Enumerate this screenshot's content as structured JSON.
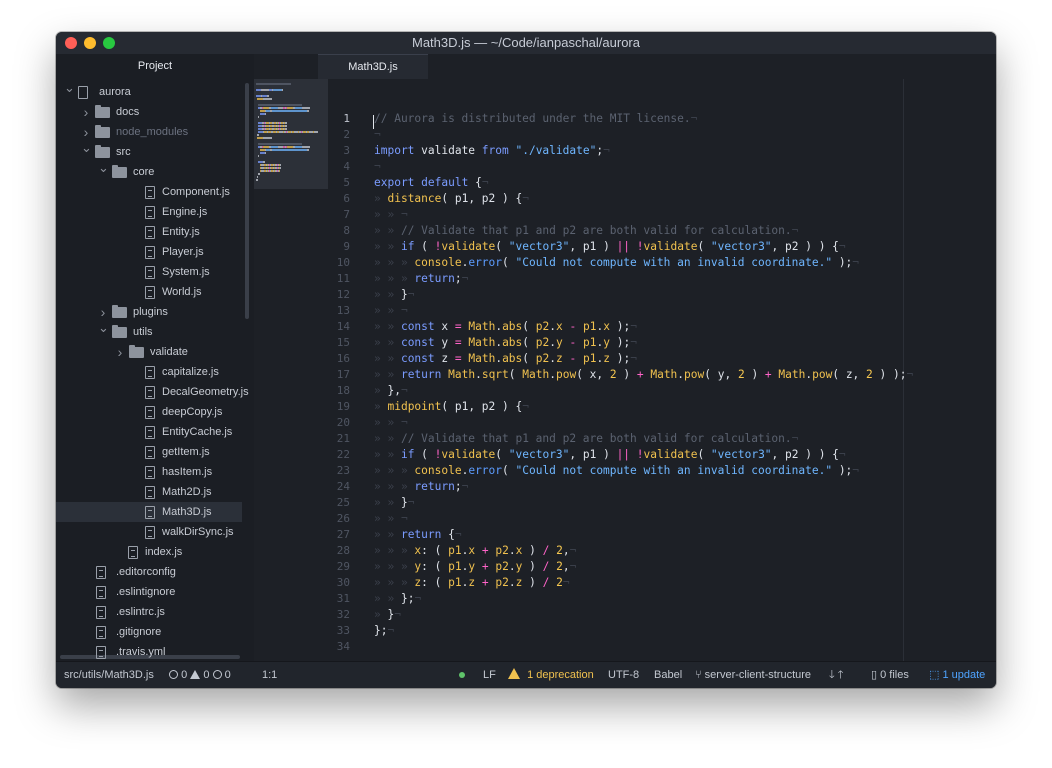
{
  "window": {
    "title": "Math3D.js — ~/Code/ianpaschal/aurora"
  },
  "tabs": {
    "project": "Project",
    "file": "Math3D.js"
  },
  "tree": [
    {
      "label": "aurora",
      "type": "repo",
      "chev": "down",
      "depth": 0
    },
    {
      "label": "docs",
      "type": "folder",
      "chev": "right",
      "depth": 1
    },
    {
      "label": "node_modules",
      "type": "folder",
      "chev": "right",
      "depth": 1,
      "dim": true
    },
    {
      "label": "src",
      "type": "folder",
      "chev": "down",
      "depth": 1
    },
    {
      "label": "core",
      "type": "folder",
      "chev": "down",
      "depth": 2
    },
    {
      "label": "Component.js",
      "type": "file",
      "depth": 3
    },
    {
      "label": "Engine.js",
      "type": "file",
      "depth": 3
    },
    {
      "label": "Entity.js",
      "type": "file",
      "depth": 3
    },
    {
      "label": "Player.js",
      "type": "file",
      "depth": 3
    },
    {
      "label": "System.js",
      "type": "file",
      "depth": 3
    },
    {
      "label": "World.js",
      "type": "file",
      "depth": 3
    },
    {
      "label": "plugins",
      "type": "folder",
      "chev": "right",
      "depth": 2
    },
    {
      "label": "utils",
      "type": "folder",
      "chev": "down",
      "depth": 2
    },
    {
      "label": "validate",
      "type": "folder",
      "chev": "right",
      "depth": 3
    },
    {
      "label": "capitalize.js",
      "type": "file",
      "depth": 3
    },
    {
      "label": "DecalGeometry.js",
      "type": "file",
      "depth": 3
    },
    {
      "label": "deepCopy.js",
      "type": "file",
      "depth": 3
    },
    {
      "label": "EntityCache.js",
      "type": "file",
      "depth": 3
    },
    {
      "label": "getItem.js",
      "type": "file",
      "depth": 3
    },
    {
      "label": "hasItem.js",
      "type": "file",
      "depth": 3
    },
    {
      "label": "Math2D.js",
      "type": "file",
      "depth": 3
    },
    {
      "label": "Math3D.js",
      "type": "file",
      "depth": 3,
      "selected": true
    },
    {
      "label": "walkDirSync.js",
      "type": "file",
      "depth": 3
    },
    {
      "label": "index.js",
      "type": "file",
      "depth": 2
    },
    {
      "label": ".editorconfig",
      "type": "file",
      "depth": 1
    },
    {
      "label": ".eslintignore",
      "type": "file",
      "depth": 1
    },
    {
      "label": ".eslintrc.js",
      "type": "file",
      "depth": 1
    },
    {
      "label": ".gitignore",
      "type": "file",
      "depth": 1
    },
    {
      "label": ".travis.yml",
      "type": "file",
      "depth": 1
    }
  ],
  "code": [
    [
      [
        "// Aurora is distributed under the MIT license.",
        "com"
      ],
      [
        "¬",
        "inv"
      ]
    ],
    [
      [
        "¬",
        "inv"
      ]
    ],
    [
      [
        "import",
        "kw"
      ],
      [
        " validate ",
        ""
      ],
      [
        "from",
        "kw"
      ],
      [
        " ",
        ""
      ],
      [
        "\"./validate\"",
        "str"
      ],
      [
        ";",
        ""
      ],
      [
        "¬",
        "inv"
      ]
    ],
    [
      [
        "¬",
        "inv"
      ]
    ],
    [
      [
        "export",
        "kw"
      ],
      [
        " ",
        ""
      ],
      [
        "default",
        "kw"
      ],
      [
        " {",
        ""
      ],
      [
        "¬",
        "inv"
      ]
    ],
    [
      [
        "» ",
        "inv"
      ],
      [
        "distance",
        "fn"
      ],
      [
        "( p1, p2 ) {",
        ""
      ],
      [
        "¬",
        "inv"
      ]
    ],
    [
      [
        "» » ",
        "inv"
      ],
      [
        "¬",
        "inv"
      ]
    ],
    [
      [
        "» » ",
        "inv"
      ],
      [
        "// Validate that p1 and p2 are both valid for calculation.",
        "com"
      ],
      [
        "¬",
        "inv"
      ]
    ],
    [
      [
        "» » ",
        "inv"
      ],
      [
        "if",
        "kw"
      ],
      [
        " ( ",
        ""
      ],
      [
        "!",
        "op"
      ],
      [
        "validate",
        "fn"
      ],
      [
        "( ",
        ""
      ],
      [
        "\"vector3\"",
        "str"
      ],
      [
        ", p1 ) ",
        ""
      ],
      [
        "||",
        "op"
      ],
      [
        " ",
        ""
      ],
      [
        "!",
        "op"
      ],
      [
        "validate",
        "fn"
      ],
      [
        "( ",
        ""
      ],
      [
        "\"vector3\"",
        "str"
      ],
      [
        ", p2 ) ) {",
        ""
      ],
      [
        "¬",
        "inv"
      ]
    ],
    [
      [
        "» » » ",
        "inv"
      ],
      [
        "console",
        "fn"
      ],
      [
        ".",
        ""
      ],
      [
        "error",
        "kw2"
      ],
      [
        "( ",
        ""
      ],
      [
        "\"Could not compute with an invalid coordinate.\"",
        "str"
      ],
      [
        " );",
        ""
      ],
      [
        "¬",
        "inv"
      ]
    ],
    [
      [
        "» » » ",
        "inv"
      ],
      [
        "return",
        "kw"
      ],
      [
        ";",
        ""
      ],
      [
        "¬",
        "inv"
      ]
    ],
    [
      [
        "» » ",
        "inv"
      ],
      [
        "}",
        ""
      ],
      [
        "¬",
        "inv"
      ]
    ],
    [
      [
        "» » ",
        "inv"
      ],
      [
        "¬",
        "inv"
      ]
    ],
    [
      [
        "» » ",
        "inv"
      ],
      [
        "const",
        "kw"
      ],
      [
        " x ",
        ""
      ],
      [
        "=",
        "op"
      ],
      [
        " ",
        ""
      ],
      [
        "Math",
        "fn"
      ],
      [
        ".",
        ""
      ],
      [
        "abs",
        "fn"
      ],
      [
        "( ",
        ""
      ],
      [
        "p2",
        "fn"
      ],
      [
        ".",
        ""
      ],
      [
        "x",
        "prop"
      ],
      [
        " ",
        ""
      ],
      [
        "-",
        "op"
      ],
      [
        " ",
        ""
      ],
      [
        "p1",
        "fn"
      ],
      [
        ".",
        ""
      ],
      [
        "x",
        "prop"
      ],
      [
        " );",
        ""
      ],
      [
        "¬",
        "inv"
      ]
    ],
    [
      [
        "» » ",
        "inv"
      ],
      [
        "const",
        "kw"
      ],
      [
        " y ",
        ""
      ],
      [
        "=",
        "op"
      ],
      [
        " ",
        ""
      ],
      [
        "Math",
        "fn"
      ],
      [
        ".",
        ""
      ],
      [
        "abs",
        "fn"
      ],
      [
        "( ",
        ""
      ],
      [
        "p2",
        "fn"
      ],
      [
        ".",
        ""
      ],
      [
        "y",
        "prop"
      ],
      [
        " ",
        ""
      ],
      [
        "-",
        "op"
      ],
      [
        " ",
        ""
      ],
      [
        "p1",
        "fn"
      ],
      [
        ".",
        ""
      ],
      [
        "y",
        "prop"
      ],
      [
        " );",
        ""
      ],
      [
        "¬",
        "inv"
      ]
    ],
    [
      [
        "» » ",
        "inv"
      ],
      [
        "const",
        "kw"
      ],
      [
        " z ",
        ""
      ],
      [
        "=",
        "op"
      ],
      [
        " ",
        ""
      ],
      [
        "Math",
        "fn"
      ],
      [
        ".",
        ""
      ],
      [
        "abs",
        "fn"
      ],
      [
        "( ",
        ""
      ],
      [
        "p2",
        "fn"
      ],
      [
        ".",
        ""
      ],
      [
        "z",
        "prop"
      ],
      [
        " ",
        ""
      ],
      [
        "-",
        "op"
      ],
      [
        " ",
        ""
      ],
      [
        "p1",
        "fn"
      ],
      [
        ".",
        ""
      ],
      [
        "z",
        "prop"
      ],
      [
        " );",
        ""
      ],
      [
        "¬",
        "inv"
      ]
    ],
    [
      [
        "» » ",
        "inv"
      ],
      [
        "return",
        "kw"
      ],
      [
        " ",
        ""
      ],
      [
        "Math",
        "fn"
      ],
      [
        ".",
        ""
      ],
      [
        "sqrt",
        "fn"
      ],
      [
        "( ",
        ""
      ],
      [
        "Math",
        "fn"
      ],
      [
        ".",
        ""
      ],
      [
        "pow",
        "fn"
      ],
      [
        "( x, ",
        ""
      ],
      [
        "2",
        "num"
      ],
      [
        " ) ",
        ""
      ],
      [
        "+",
        "op"
      ],
      [
        " ",
        ""
      ],
      [
        "Math",
        "fn"
      ],
      [
        ".",
        ""
      ],
      [
        "pow",
        "fn"
      ],
      [
        "( y, ",
        ""
      ],
      [
        "2",
        "num"
      ],
      [
        " ) ",
        ""
      ],
      [
        "+",
        "op"
      ],
      [
        " ",
        ""
      ],
      [
        "Math",
        "fn"
      ],
      [
        ".",
        ""
      ],
      [
        "pow",
        "fn"
      ],
      [
        "( z, ",
        ""
      ],
      [
        "2",
        "num"
      ],
      [
        " ) );",
        ""
      ],
      [
        "¬",
        "inv"
      ]
    ],
    [
      [
        "» ",
        "inv"
      ],
      [
        "},",
        ""
      ],
      [
        "¬",
        "inv"
      ]
    ],
    [
      [
        "» ",
        "inv"
      ],
      [
        "midpoint",
        "fn"
      ],
      [
        "( p1, p2 ) {",
        ""
      ],
      [
        "¬",
        "inv"
      ]
    ],
    [
      [
        "» » ",
        "inv"
      ],
      [
        "¬",
        "inv"
      ]
    ],
    [
      [
        "» » ",
        "inv"
      ],
      [
        "// Validate that p1 and p2 are both valid for calculation.",
        "com"
      ],
      [
        "¬",
        "inv"
      ]
    ],
    [
      [
        "» » ",
        "inv"
      ],
      [
        "if",
        "kw"
      ],
      [
        " ( ",
        ""
      ],
      [
        "!",
        "op"
      ],
      [
        "validate",
        "fn"
      ],
      [
        "( ",
        ""
      ],
      [
        "\"vector3\"",
        "str"
      ],
      [
        ", p1 ) ",
        ""
      ],
      [
        "||",
        "op"
      ],
      [
        " ",
        ""
      ],
      [
        "!",
        "op"
      ],
      [
        "validate",
        "fn"
      ],
      [
        "( ",
        ""
      ],
      [
        "\"vector3\"",
        "str"
      ],
      [
        ", p2 ) ) {",
        ""
      ],
      [
        "¬",
        "inv"
      ]
    ],
    [
      [
        "» » » ",
        "inv"
      ],
      [
        "console",
        "fn"
      ],
      [
        ".",
        ""
      ],
      [
        "error",
        "kw2"
      ],
      [
        "( ",
        ""
      ],
      [
        "\"Could not compute with an invalid coordinate.\"",
        "str"
      ],
      [
        " );",
        ""
      ],
      [
        "¬",
        "inv"
      ]
    ],
    [
      [
        "» » » ",
        "inv"
      ],
      [
        "return",
        "kw"
      ],
      [
        ";",
        ""
      ],
      [
        "¬",
        "inv"
      ]
    ],
    [
      [
        "» » ",
        "inv"
      ],
      [
        "}",
        ""
      ],
      [
        "¬",
        "inv"
      ]
    ],
    [
      [
        "» » ",
        "inv"
      ],
      [
        "¬",
        "inv"
      ]
    ],
    [
      [
        "» » ",
        "inv"
      ],
      [
        "return",
        "kw"
      ],
      [
        " {",
        ""
      ],
      [
        "¬",
        "inv"
      ]
    ],
    [
      [
        "» » » ",
        "inv"
      ],
      [
        "x",
        "prop"
      ],
      [
        ": ( ",
        ""
      ],
      [
        "p1",
        "fn"
      ],
      [
        ".",
        ""
      ],
      [
        "x",
        "prop"
      ],
      [
        " ",
        ""
      ],
      [
        "+",
        "op"
      ],
      [
        " ",
        ""
      ],
      [
        "p2",
        "fn"
      ],
      [
        ".",
        ""
      ],
      [
        "x",
        "prop"
      ],
      [
        " ) ",
        ""
      ],
      [
        "/",
        "op"
      ],
      [
        " ",
        ""
      ],
      [
        "2",
        "num"
      ],
      [
        ",",
        ""
      ],
      [
        "¬",
        "inv"
      ]
    ],
    [
      [
        "» » » ",
        "inv"
      ],
      [
        "y",
        "prop"
      ],
      [
        ": ( ",
        ""
      ],
      [
        "p1",
        "fn"
      ],
      [
        ".",
        ""
      ],
      [
        "y",
        "prop"
      ],
      [
        " ",
        ""
      ],
      [
        "+",
        "op"
      ],
      [
        " ",
        ""
      ],
      [
        "p2",
        "fn"
      ],
      [
        ".",
        ""
      ],
      [
        "y",
        "prop"
      ],
      [
        " ) ",
        ""
      ],
      [
        "/",
        "op"
      ],
      [
        " ",
        ""
      ],
      [
        "2",
        "num"
      ],
      [
        ",",
        ""
      ],
      [
        "¬",
        "inv"
      ]
    ],
    [
      [
        "» » » ",
        "inv"
      ],
      [
        "z",
        "prop"
      ],
      [
        ": ( ",
        ""
      ],
      [
        "p1",
        "fn"
      ],
      [
        ".",
        ""
      ],
      [
        "z",
        "prop"
      ],
      [
        " ",
        ""
      ],
      [
        "+",
        "op"
      ],
      [
        " ",
        ""
      ],
      [
        "p2",
        "fn"
      ],
      [
        ".",
        ""
      ],
      [
        "z",
        "prop"
      ],
      [
        " ) ",
        ""
      ],
      [
        "/",
        "op"
      ],
      [
        " ",
        ""
      ],
      [
        "2",
        "num"
      ],
      [
        "¬",
        "inv"
      ]
    ],
    [
      [
        "» » ",
        "inv"
      ],
      [
        "};",
        ""
      ],
      [
        "¬",
        "inv"
      ]
    ],
    [
      [
        "» ",
        "inv"
      ],
      [
        "}",
        ""
      ],
      [
        "¬",
        "inv"
      ]
    ],
    [
      [
        "};",
        ""
      ],
      [
        "¬",
        "inv"
      ]
    ],
    [
      [
        "",
        ""
      ]
    ]
  ],
  "status": {
    "path": "src/utils/Math3D.js",
    "errors": "0",
    "warnings": "0",
    "infos": "0",
    "cursor": "1:1",
    "line_ending": "LF",
    "deprecation": "1 deprecation",
    "encoding": "UTF-8",
    "grammar": "Babel",
    "branch": "server-client-structure",
    "files": "0 files",
    "update": "1 update"
  },
  "colors": {
    "comment": "#5b6270",
    "keyword": "#7b9cff",
    "string": "#6fb6ff",
    "function": "#f0c14f",
    "operator": "#ff63c8",
    "update": "#4ea3ff"
  }
}
